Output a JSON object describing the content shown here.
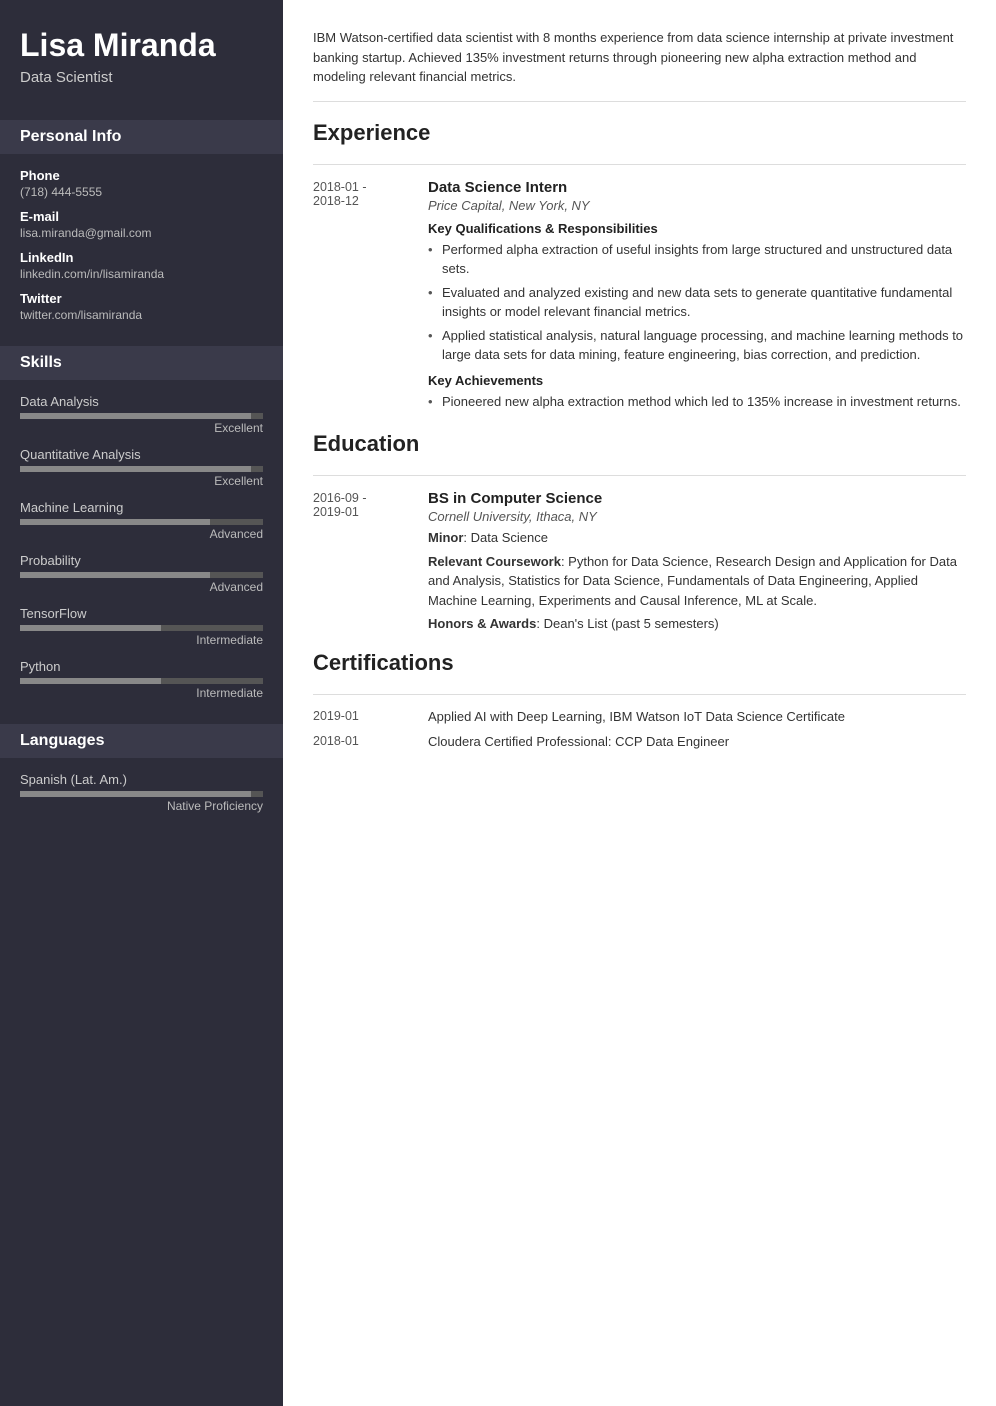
{
  "sidebar": {
    "name": "Lisa Miranda",
    "title": "Data Scientist",
    "sections": {
      "personal": {
        "title": "Personal Info",
        "fields": [
          {
            "label": "Phone",
            "value": "(718) 444-5555"
          },
          {
            "label": "E-mail",
            "value": "lisa.miranda@gmail.com"
          },
          {
            "label": "LinkedIn",
            "value": "linkedin.com/in/lisamiranda"
          },
          {
            "label": "Twitter",
            "value": "twitter.com/lisamiranda"
          }
        ]
      },
      "skills": {
        "title": "Skills",
        "items": [
          {
            "name": "Data Analysis",
            "level": "Excellent",
            "pct": 95
          },
          {
            "name": "Quantitative Analysis",
            "level": "Excellent",
            "pct": 95
          },
          {
            "name": "Machine Learning",
            "level": "Advanced",
            "pct": 78
          },
          {
            "name": "Probability",
            "level": "Advanced",
            "pct": 78
          },
          {
            "name": "TensorFlow",
            "level": "Intermediate",
            "pct": 58
          },
          {
            "name": "Python",
            "level": "Intermediate",
            "pct": 58
          }
        ]
      },
      "languages": {
        "title": "Languages",
        "items": [
          {
            "name": "Spanish (Lat. Am.)",
            "level": "Native Proficiency",
            "pct": 95
          }
        ]
      }
    }
  },
  "main": {
    "summary": "IBM Watson-certified data scientist with 8 months experience from data science internship at private investment banking startup. Achieved 135% investment returns through pioneering new alpha extraction method and modeling relevant financial metrics.",
    "experience": {
      "title": "Experience",
      "entries": [
        {
          "date": "2018-01 -\n2018-12",
          "job_title": "Data Science Intern",
          "company": "Price Capital, New York, NY",
          "qualifications_label": "Key Qualifications & Responsibilities",
          "qualifications": [
            "Performed alpha extraction of useful insights from large structured and unstructured data sets.",
            "Evaluated and analyzed existing and new data sets to generate quantitative fundamental insights or model relevant financial metrics.",
            "Applied statistical analysis, natural language processing, and machine learning methods to large data sets for data mining, feature engineering, bias correction, and prediction."
          ],
          "achievements_label": "Key Achievements",
          "achievements": [
            "Pioneered new alpha extraction method which led to 135% increase in investment returns."
          ]
        }
      ]
    },
    "education": {
      "title": "Education",
      "entries": [
        {
          "date": "2016-09 -\n2019-01",
          "degree": "BS in Computer Science",
          "school": "Cornell University, Ithaca, NY",
          "minor_label": "Minor",
          "minor": "Data Science",
          "coursework_label": "Relevant Coursework",
          "coursework": "Python for Data Science, Research Design and Application for Data and Analysis, Statistics for Data Science, Fundamentals of Data Engineering, Applied Machine Learning, Experiments and Causal Inference, ML at Scale.",
          "honors_label": "Honors & Awards",
          "honors": "Dean's List (past 5 semesters)"
        }
      ]
    },
    "certifications": {
      "title": "Certifications",
      "entries": [
        {
          "date": "2019-01",
          "text": "Applied AI with Deep Learning, IBM Watson IoT Data Science Certificate"
        },
        {
          "date": "2018-01",
          "text": "Cloudera Certified Professional: CCP Data Engineer"
        }
      ]
    }
  }
}
